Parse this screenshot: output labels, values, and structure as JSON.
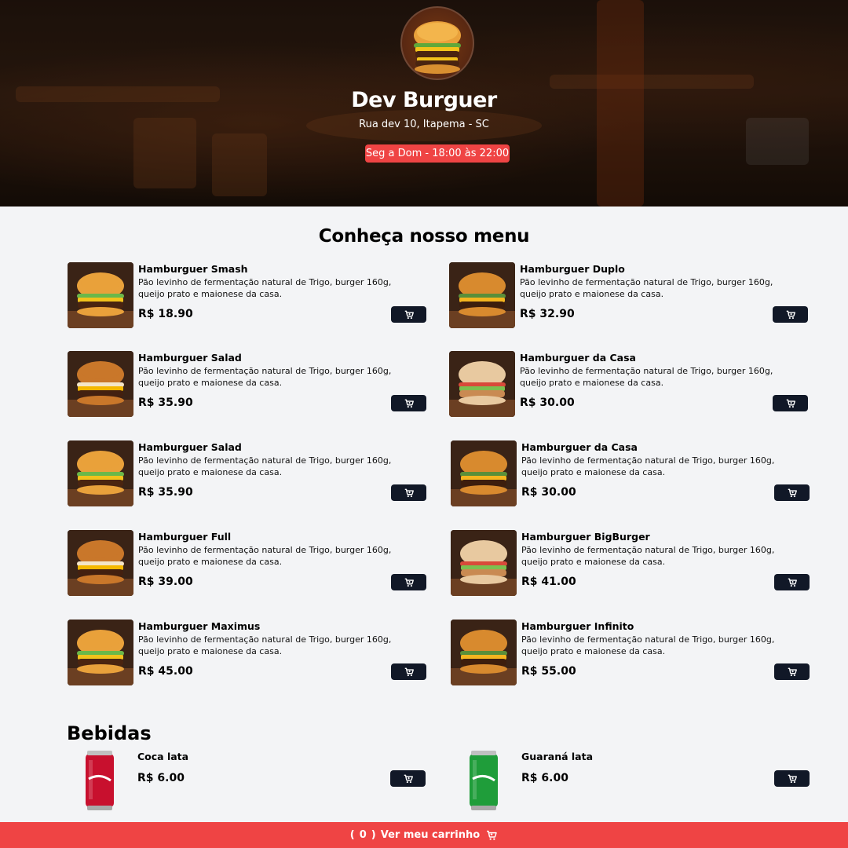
{
  "header": {
    "brand": "Dev Burguer",
    "address": "Rua dev 10, Itapema - SC",
    "hours": "Seg a Dom - 18:00 às 22:00"
  },
  "menu": {
    "title": "Conheça nosso menu",
    "items": [
      {
        "name": "Hamburguer Smash",
        "desc": "Pão levinho de fermentação natural de Trigo, burger 160g, queijo prato e maionese da casa.",
        "price": "R$ 18.90"
      },
      {
        "name": "Hamburguer Duplo",
        "desc": "Pão levinho de fermentação natural de Trigo, burger 160g, queijo prato e maionese da casa.",
        "price": "R$ 32.90"
      },
      {
        "name": "Hamburguer Salad",
        "desc": "Pão levinho de fermentação natural de Trigo, burger 160g, queijo prato e maionese da casa.",
        "price": "R$ 35.90"
      },
      {
        "name": "Hamburguer da Casa",
        "desc": "Pão levinho de fermentação natural de Trigo, burger 160g, queijo prato e maionese da casa.",
        "price": "R$ 30.00"
      },
      {
        "name": "Hamburguer Salad",
        "desc": "Pão levinho de fermentação natural de Trigo, burger 160g, queijo prato e maionese da casa.",
        "price": "R$ 35.90"
      },
      {
        "name": "Hamburguer da Casa",
        "desc": "Pão levinho de fermentação natural de Trigo, burger 160g, queijo prato e maionese da casa.",
        "price": "R$ 30.00"
      },
      {
        "name": "Hamburguer Full",
        "desc": "Pão levinho de fermentação natural de Trigo, burger 160g, queijo prato e maionese da casa.",
        "price": "R$ 39.00"
      },
      {
        "name": "Hamburguer BigBurger",
        "desc": "Pão levinho de fermentação natural de Trigo, burger 160g, queijo prato e maionese da casa.",
        "price": "R$ 41.00"
      },
      {
        "name": "Hamburguer Maximus",
        "desc": "Pão levinho de fermentação natural de Trigo, burger 160g, queijo prato e maionese da casa.",
        "price": "R$ 45.00"
      },
      {
        "name": "Hamburguer Infinito",
        "desc": "Pão levinho de fermentação natural de Trigo, burger 160g, queijo prato e maionese da casa.",
        "price": "R$ 55.00"
      }
    ]
  },
  "drinks": {
    "title": "Bebidas",
    "items": [
      {
        "name": "Coca lata",
        "price": "R$ 6.00",
        "color": "#c8102e"
      },
      {
        "name": "Guaraná lata",
        "price": "R$ 6.00",
        "color": "#1f9d3a"
      }
    ]
  },
  "cart": {
    "open_paren": "(",
    "count": "0",
    "close_paren": ")",
    "label": "Ver meu carrinho"
  },
  "icons": {
    "cart": "cart-icon"
  },
  "colors": {
    "accent": "#ef4444",
    "button": "#111827",
    "background": "#f3f4f6"
  }
}
